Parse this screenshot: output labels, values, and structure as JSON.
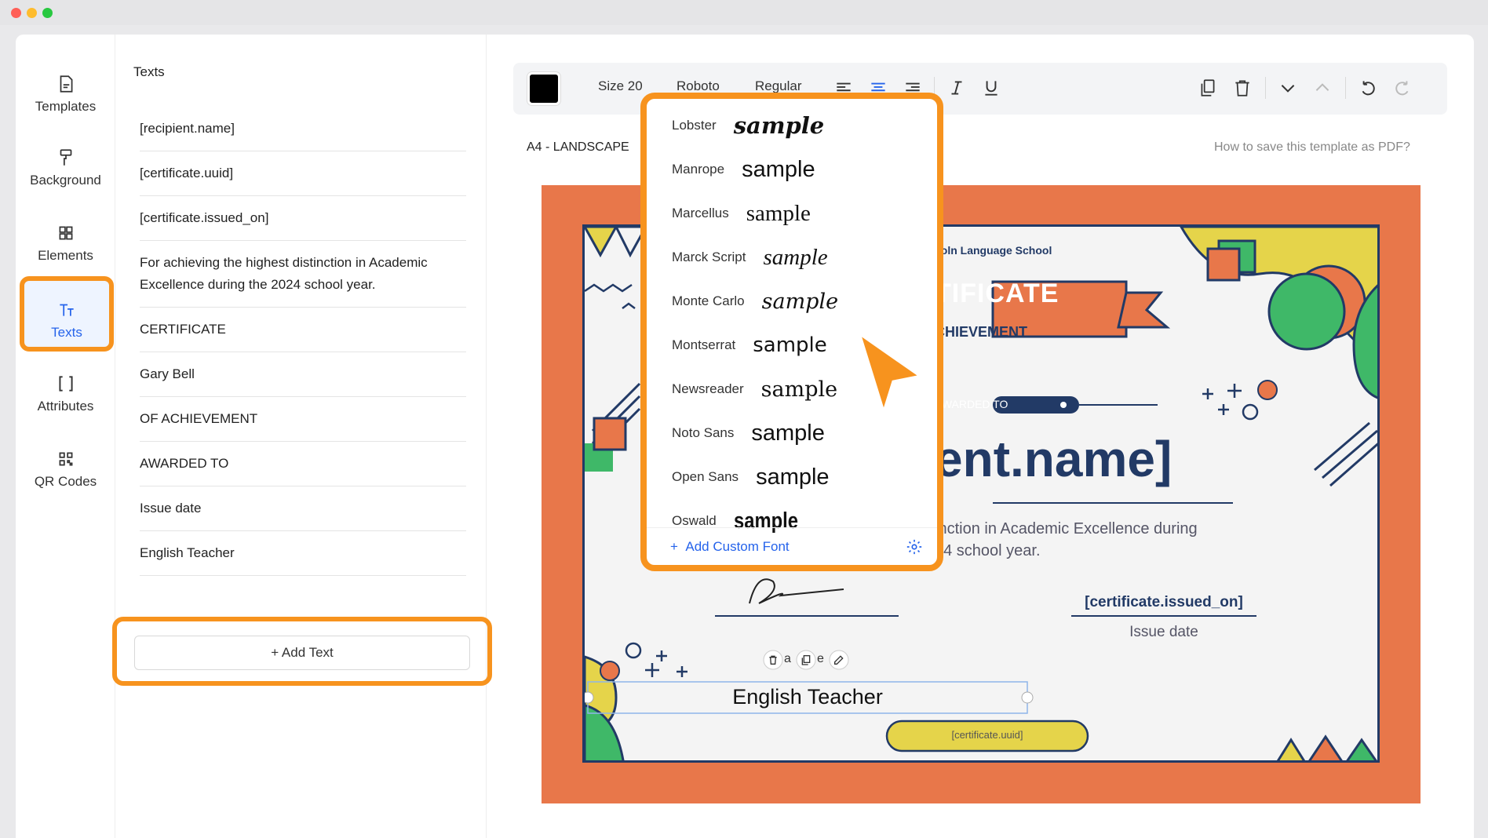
{
  "sidebar": {
    "items": [
      {
        "label": "Templates",
        "icon": "template-icon"
      },
      {
        "label": "Background",
        "icon": "paint-roller-icon"
      },
      {
        "label": "Elements",
        "icon": "elements-icon"
      },
      {
        "label": "Texts",
        "icon": "text-icon"
      },
      {
        "label": "Attributes",
        "icon": "brackets-icon"
      },
      {
        "label": "QR Codes",
        "icon": "qr-icon"
      }
    ],
    "active": "Texts"
  },
  "texts_panel": {
    "title": "Texts",
    "items": [
      "[recipient.name]",
      "[certificate.uuid]",
      "[certificate.issued_on]",
      "For achieving the highest distinction in Academic Excellence during the 2024 school year.",
      "CERTIFICATE",
      "Gary Bell",
      "OF ACHIEVEMENT",
      "AWARDED TO",
      "Issue date",
      "English Teacher"
    ],
    "add_label": "+ Add Text"
  },
  "toolbar": {
    "color": "#000000",
    "size": "Size 20",
    "font": "Roboto",
    "weight": "Regular"
  },
  "canvas": {
    "paper_label": "A4 - LANDSCAPE",
    "help_link": "How to save this template as PDF?",
    "cert": {
      "school": "coln Language School",
      "title": "TIFICATE",
      "subtitle": "CHIEVEMENT",
      "awarded": "AWARDED TO",
      "recipient": "ent.name]",
      "desc_line1": "inction in Academic Excellence during",
      "desc_line2": "24 school year.",
      "issued_on": "[certificate.issued_on]",
      "issue_label": "Issue date",
      "teacher": "English Teacher",
      "uuid": "[certificate.uuid]",
      "partial_name": "a",
      "partial_name2": "e"
    }
  },
  "font_menu": {
    "fonts": [
      {
        "name": "Lobster",
        "sample": "sample"
      },
      {
        "name": "Manrope",
        "sample": "sample"
      },
      {
        "name": "Marcellus",
        "sample": "sample"
      },
      {
        "name": "Marck Script",
        "sample": "sample"
      },
      {
        "name": "Monte Carlo",
        "sample": "sample"
      },
      {
        "name": "Montserrat",
        "sample": "sample"
      },
      {
        "name": "Newsreader",
        "sample": "sample"
      },
      {
        "name": "Noto Sans",
        "sample": "sample"
      },
      {
        "name": "Open Sans",
        "sample": "sample"
      },
      {
        "name": "Oswald",
        "sample": "sample"
      }
    ],
    "add_custom": "Add Custom Font"
  },
  "colors": {
    "accent": "#2563eb",
    "highlight": "#f7931e",
    "cert_orange": "#e8774a",
    "cert_navy": "#223a66",
    "cert_green": "#3fb868",
    "cert_yellow": "#e5d44a"
  }
}
